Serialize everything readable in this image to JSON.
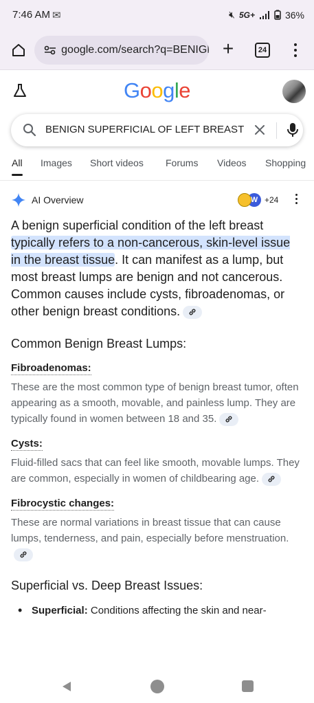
{
  "status": {
    "time": "7:46 AM",
    "network": "5G+",
    "battery": "36%"
  },
  "browser": {
    "url": "google.com/search?q=BENIGN",
    "tab_count": "24"
  },
  "google": {
    "logo_letters": [
      "G",
      "o",
      "o",
      "g",
      "l",
      "e"
    ]
  },
  "search": {
    "query": "BENIGN SUPERFICIAL OF LEFT BREAST"
  },
  "tabs": [
    "All",
    "Images",
    "Short videos",
    "Forums",
    "Videos",
    "Shopping"
  ],
  "ai_overview": {
    "title": "AI Overview",
    "sources_count": "+24",
    "source_letter": "W"
  },
  "content": {
    "lead_pre": "A benign superficial condition of the left breast ",
    "lead_highlight": "typically refers to a non-cancerous, skin-level issue in the breast tissue",
    "lead_post": ". It can manifest as a lump, but most breast lumps are benign and not cancerous. Common causes include cysts, fibroadenomas, or other benign breast conditions.",
    "section1_title": "Common Benign Breast Lumps:",
    "items": [
      {
        "heading": "Fibroadenomas:",
        "text": "These are the most common type of benign breast tumor, often appearing as a smooth, movable, and painless lump. They are typically found in women between 18 and 35."
      },
      {
        "heading": "Cysts:",
        "text": "Fluid-filled sacs that can feel like smooth, movable lumps. They are common, especially in women of childbearing age."
      },
      {
        "heading": "Fibrocystic changes:",
        "text": "These are normal variations in breast tissue that can cause lumps, tenderness, and pain, especially before menstruation."
      }
    ],
    "section2_title": "Superficial vs. Deep Breast Issues:",
    "bullet_label": "Superficial:",
    "bullet_text": " Conditions affecting the skin and near-"
  },
  "colors": {
    "accent": "#4285f4",
    "highlight": "#d3e3fd",
    "chrome_bg": "#f3eef6"
  }
}
